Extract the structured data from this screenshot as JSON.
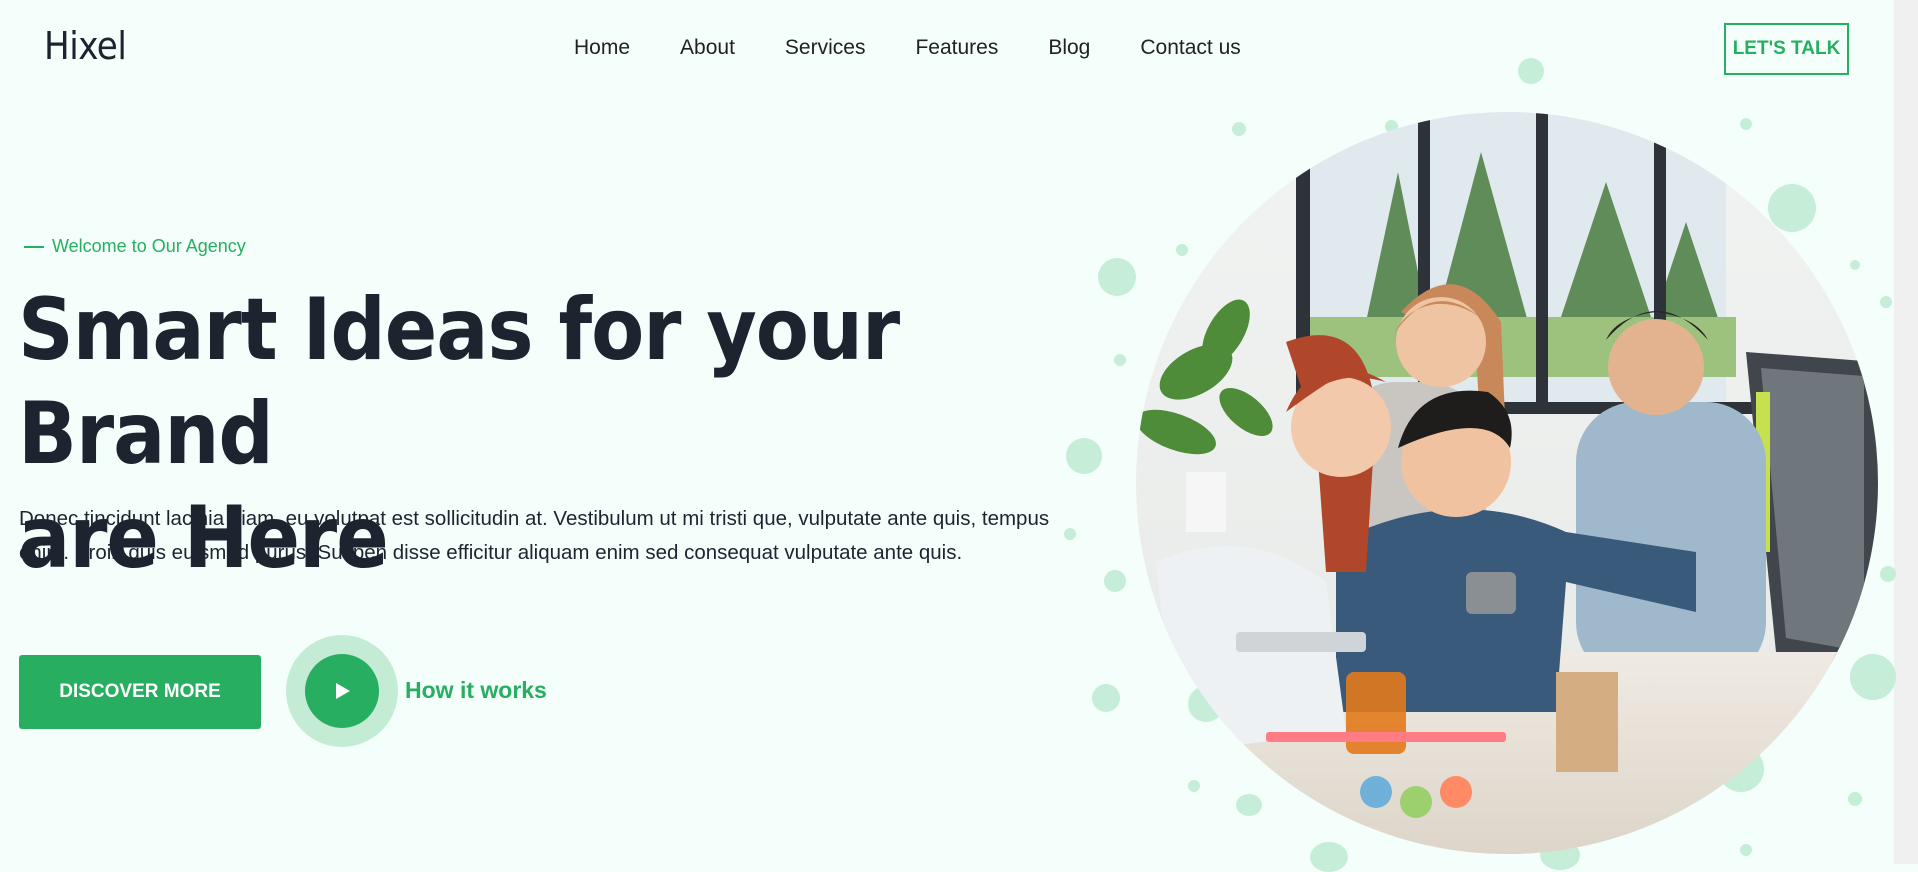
{
  "brand": {
    "logo": "Hixel",
    "accent": "#28ae60",
    "accent_soft": "#c4ecd5",
    "background": "#f4fffb",
    "text": "#1d2430"
  },
  "nav": {
    "items": [
      "Home",
      "About",
      "Services",
      "Features",
      "Blog",
      "Contact us"
    ]
  },
  "header": {
    "cta_label": "LET'S TALK"
  },
  "hero": {
    "eyebrow": "Welcome to Our Agency",
    "headline_line1": "Smart Ideas for your Brand",
    "headline_line2": "are Here",
    "description": "Donec tincidunt lacinia diam, eu volutpat est sollicitudin at. Vestibulum ut mi tristi que, vulputate ante quis, tempus enim. Proin quis euismod purus. Suspen disse efficitur aliquam enim sed consequat vulputate ante quis.",
    "primary_button": "DISCOVER MORE",
    "video_link": "How it works",
    "play_icon": "play-icon",
    "image_icon": "team-photo"
  }
}
